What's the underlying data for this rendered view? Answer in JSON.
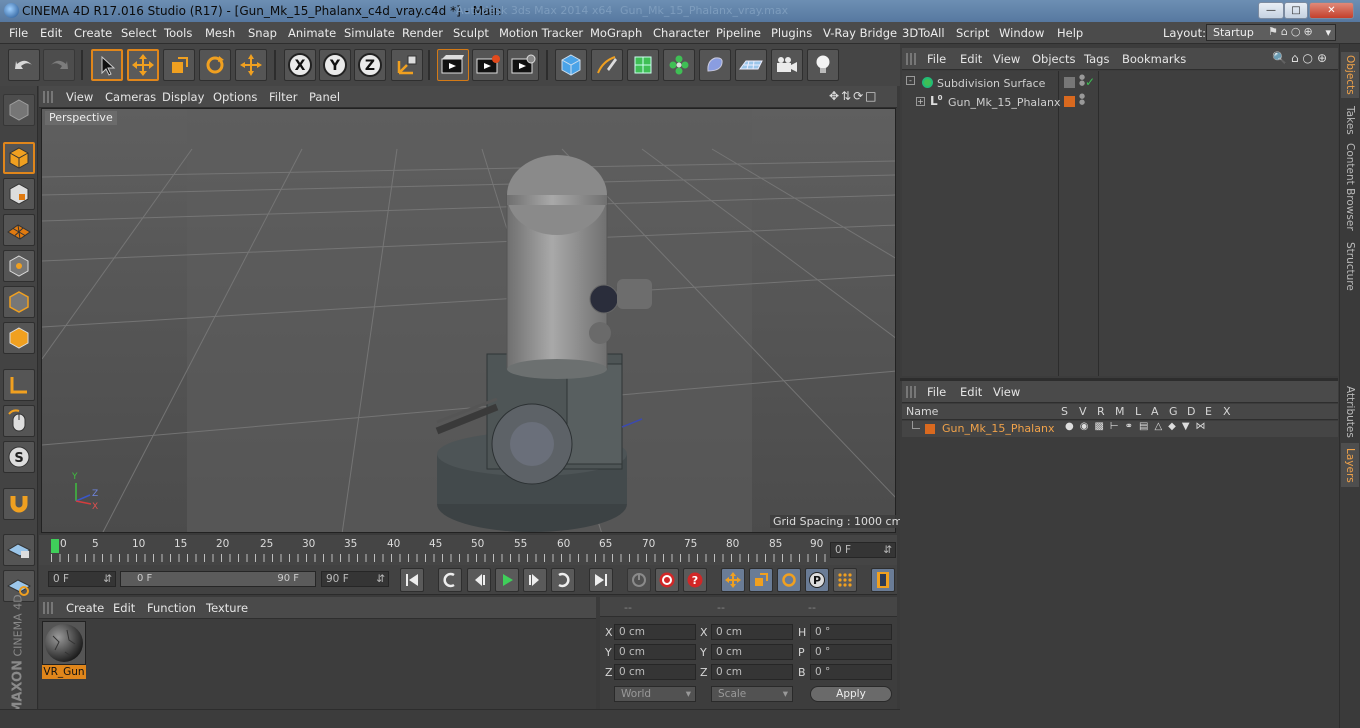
{
  "window": {
    "title": "CINEMA 4D R17.016 Studio (R17) - [Gun_Mk_15_Phalanx_c4d_vray.c4d *] - Main",
    "ghost_title_1": "Autodesk 3ds Max 2014 x64",
    "ghost_title_2": "Gun_Mk_15_Phalanx_vray.max"
  },
  "menu": [
    "File",
    "Edit",
    "Create",
    "Select",
    "Tools",
    "Mesh",
    "Snap",
    "Animate",
    "Simulate",
    "Render",
    "Sculpt",
    "Motion Tracker",
    "MoGraph",
    "Character",
    "Pipeline",
    "Plugins",
    "V-Ray Bridge",
    "3DToAll",
    "Script",
    "Window",
    "Help"
  ],
  "layout": {
    "label": "Layout:",
    "value": "Startup"
  },
  "viewport": {
    "menu": [
      "View",
      "Cameras",
      "Display",
      "Options",
      "Filter",
      "Panel"
    ],
    "label": "Perspective",
    "grid_spacing": "Grid Spacing : 1000 cm",
    "axis_y": "Y",
    "axis_z": "Z",
    "axis_x": "X"
  },
  "timeline": {
    "ticks": [
      "0",
      "5",
      "10",
      "15",
      "20",
      "25",
      "30",
      "35",
      "40",
      "45",
      "50",
      "55",
      "60",
      "65",
      "70",
      "75",
      "80",
      "85",
      "90"
    ],
    "current_frame": "0 F",
    "start_field": "0 F",
    "range_start": "0 F",
    "range_end": "90 F",
    "end_field": "90 F"
  },
  "material_manager": {
    "menu": [
      "Create",
      "Edit",
      "Function",
      "Texture"
    ],
    "material_name": "VR_Gun"
  },
  "coordinates": {
    "headers": [
      "--",
      "--",
      "--"
    ],
    "rows": [
      {
        "a": "X",
        "av": "0 cm",
        "b": "X",
        "bv": "0 cm",
        "c": "H",
        "cv": "0 °"
      },
      {
        "a": "Y",
        "av": "0 cm",
        "b": "Y",
        "bv": "0 cm",
        "c": "P",
        "cv": "0 °"
      },
      {
        "a": "Z",
        "av": "0 cm",
        "b": "Z",
        "bv": "0 cm",
        "c": "B",
        "cv": "0 °"
      }
    ],
    "world": "World",
    "scale": "Scale",
    "apply": "Apply"
  },
  "object_manager": {
    "menu": [
      "File",
      "Edit",
      "View",
      "Objects",
      "Tags",
      "Bookmarks"
    ],
    "items": [
      {
        "name": "Subdivision Surface"
      },
      {
        "name": "Gun_Mk_15_Phalanx"
      }
    ]
  },
  "layer_manager": {
    "menu": [
      "File",
      "Edit",
      "View"
    ],
    "columns": [
      "Name",
      "S",
      "V",
      "R",
      "M",
      "L",
      "A",
      "G",
      "D",
      "E",
      "X"
    ],
    "layer_name": "Gun_Mk_15_Phalanx"
  },
  "side_tabs": [
    "Objects",
    "Takes",
    "Content Browser",
    "Structure",
    "Attributes",
    "Layers"
  ],
  "branding": {
    "line1": "MAXON",
    "line2": "CINEMA 4D"
  },
  "colors": {
    "accent": "#e0861b",
    "layer_color": "#d9691f",
    "title_bar": "#5f80a8"
  }
}
